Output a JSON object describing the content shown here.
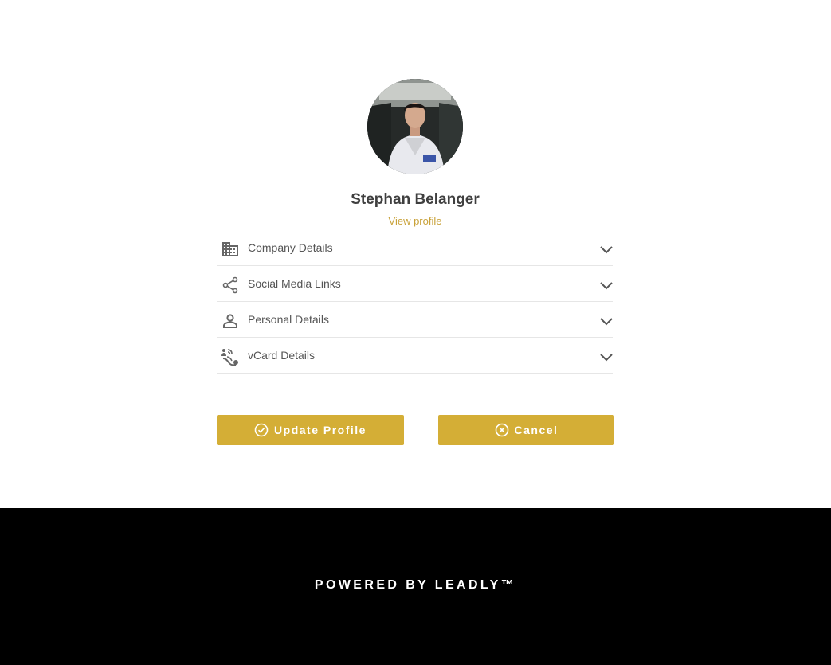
{
  "profile": {
    "name": "Stephan Belanger",
    "view_profile_label": "View profile"
  },
  "sections": [
    {
      "label": "Company Details",
      "icon": "building-icon"
    },
    {
      "label": "Social Media Links",
      "icon": "share-icon"
    },
    {
      "label": "Personal Details",
      "icon": "person-icon"
    },
    {
      "label": "vCard Details",
      "icon": "contact-wireless-icon"
    }
  ],
  "actions": {
    "update_label": "Update Profile",
    "cancel_label": "Cancel"
  },
  "footer": {
    "text": "POWERED BY LEADLY™"
  },
  "colors": {
    "accent": "#d4ae36",
    "link": "#c9a23a",
    "footer_bg": "#000000",
    "text_dark": "#3f3f3f"
  }
}
